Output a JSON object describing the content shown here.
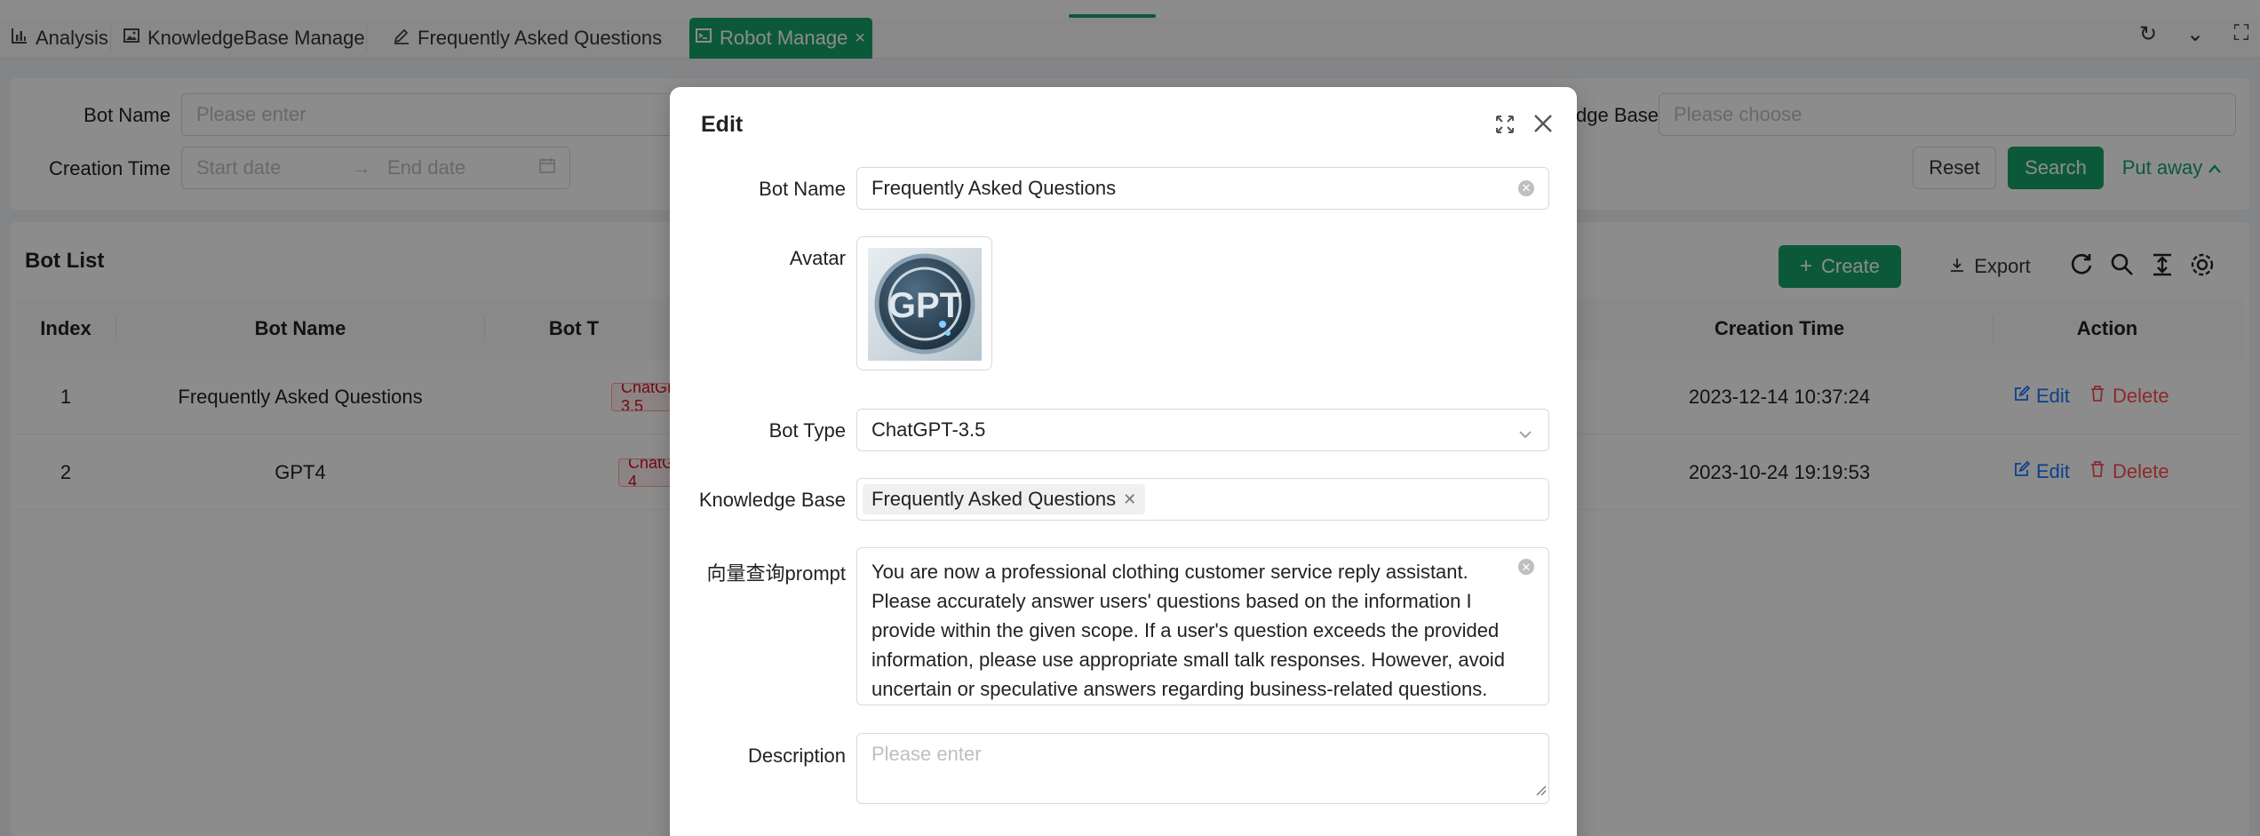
{
  "tabs": [
    {
      "label": "Analysis",
      "icon": "bar-chart-icon"
    },
    {
      "label": "KnowledgeBase Manage",
      "icon": "picture-icon"
    },
    {
      "label": "Frequently Asked Questions",
      "icon": "edit-icon"
    },
    {
      "label": "Robot Manage",
      "icon": "code-icon",
      "active": true
    }
  ],
  "tab_close": "×",
  "toolbar_icons": {
    "reload": "↻",
    "more": "⌄",
    "fullscreen": "⛶"
  },
  "search_form": {
    "bot_name_label": "Bot Name",
    "bot_name_placeholder": "Please enter",
    "kb_label_visible": "dge Base",
    "kb_placeholder": "Please choose",
    "creation_time_label": "Creation Time",
    "start_placeholder": "Start date",
    "arrow": "→",
    "end_placeholder": "End date",
    "reset": "Reset",
    "search": "Search",
    "put_away": "Put away"
  },
  "list": {
    "title": "Bot List",
    "create": "Create",
    "export": "Export",
    "columns": [
      "Index",
      "Bot Name",
      "Bot T",
      "Creation Time",
      "Action"
    ],
    "rows": [
      {
        "index": "1",
        "name": "Frequently Asked Questions",
        "type_tag": "ChatGPT-3.5",
        "time": "2023-12-14 10:37:24"
      },
      {
        "index": "2",
        "name": "GPT4",
        "type_tag": "ChatGPT-4",
        "time": "2023-10-24 19:19:53"
      }
    ],
    "edit": "Edit",
    "delete": "Delete"
  },
  "modal": {
    "title": "Edit",
    "bot_name_label": "Bot Name",
    "bot_name_value": "Frequently Asked Questions",
    "avatar_label": "Avatar",
    "avatar_letters": "GPT",
    "bot_type_label": "Bot Type",
    "bot_type_value": "ChatGPT-3.5",
    "kb_label": "Knowledge Base",
    "kb_tag": "Frequently Asked Questions",
    "prompt_label": "向量查询prompt",
    "prompt_value": "You are now a professional clothing customer service reply assistant. Please accurately answer users' questions based on the information I provide within the given scope. If a user's question exceeds the provided information, please use appropriate small talk responses. However, avoid uncertain or speculative answers regarding business-related questions.",
    "description_label": "Description",
    "description_placeholder": "Please enter"
  },
  "colors": {
    "primary": "#16a36b",
    "link": "#1677ff",
    "danger": "#ff4d4f"
  }
}
